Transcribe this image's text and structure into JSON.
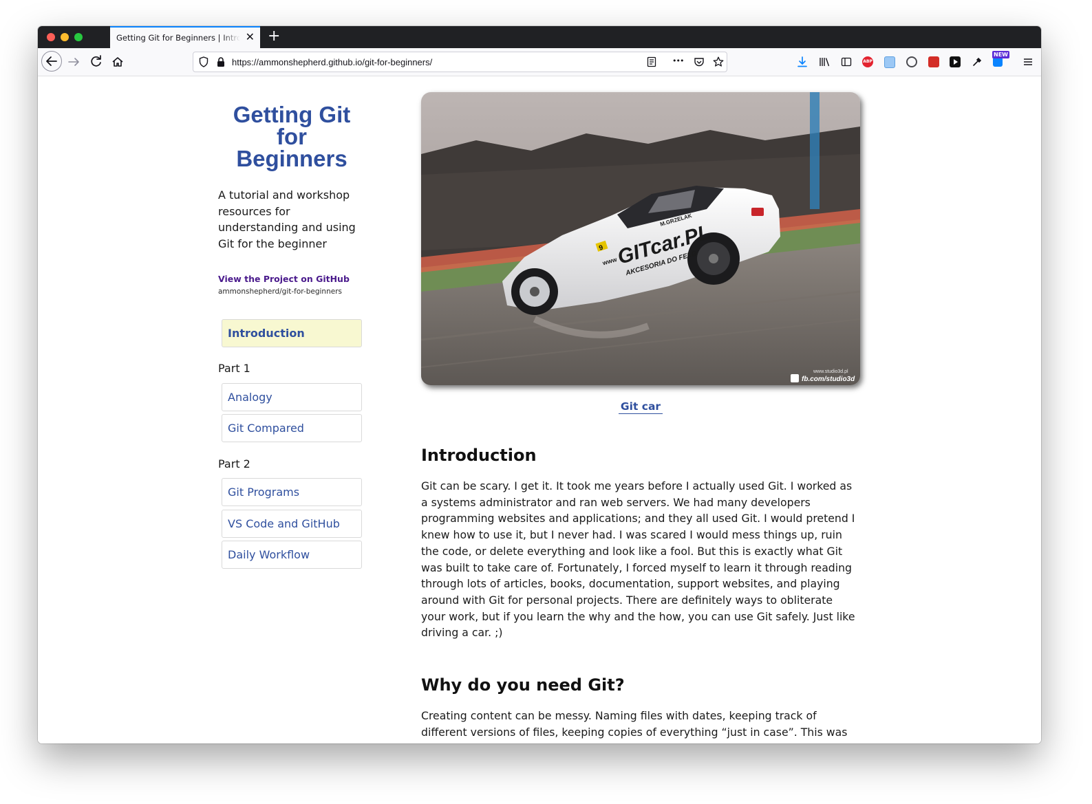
{
  "browser": {
    "tab_title": "Getting Git for Beginners | Introduction",
    "tab_close_glyph": "✕",
    "new_tab_glyph": "+",
    "url": "https://ammonshepherd.github.io/git-for-beginners/",
    "overflow_glyph": "•••",
    "new_badge": "NEW",
    "abp_label": "ABP"
  },
  "sidebar": {
    "title": "Getting Git for Beginners",
    "tagline": "A tutorial and workshop resources for understanding and using Git for the beginner",
    "github_link": "View the Project on GitHub",
    "github_repo": "ammonshepherd/git-for-beginners",
    "nav_intro": "Introduction",
    "part1_label": "Part 1",
    "part1_items": [
      "Analogy",
      "Git Compared"
    ],
    "part2_label": "Part 2",
    "part2_items": [
      "Git Programs",
      "VS Code and GitHub",
      "Daily Workflow"
    ]
  },
  "main": {
    "hero_caption": "Git car",
    "car_texts": {
      "brand": "GITcar.PL",
      "sub": "AKCESORIA DO FELG",
      "web": "www",
      "driver": "M.GRZELAK",
      "number": "9",
      "watermark": "fb.com/studio3d",
      "watermark_site": "www.studio3d.pl"
    },
    "intro_heading": "Introduction",
    "intro_text": "Git can be scary. I get it. It took me years before I actually used Git. I worked as a systems administrator and ran web servers. We had many developers programming websites and applications; and they all used Git. I would pretend I knew how to use it, but I never had. I was scared I would mess things up, ruin the code, or delete everything and look like a fool. But this is exactly what Git was built to take care of. Fortunately, I forced myself to learn it through reading through lots of articles, books, documentation, support websites, and playing around with Git for personal projects. There are definitely ways to obliterate your work, but if you learn the why and the how, you can use Git safely. Just like driving a car. ;)",
    "why_heading": "Why do you need Git?",
    "why_text": "Creating content can be messy. Naming files with dates, keeping track of different versions of files, keeping copies of everything “just in case”. This was especially true for me while learning web development and maintaining old files."
  },
  "colors": {
    "accent": "#2f4f9e",
    "active_nav_bg": "#f8f8d1",
    "link_visited": "#4a1a8c",
    "tab_accent": "#0a84ff"
  }
}
